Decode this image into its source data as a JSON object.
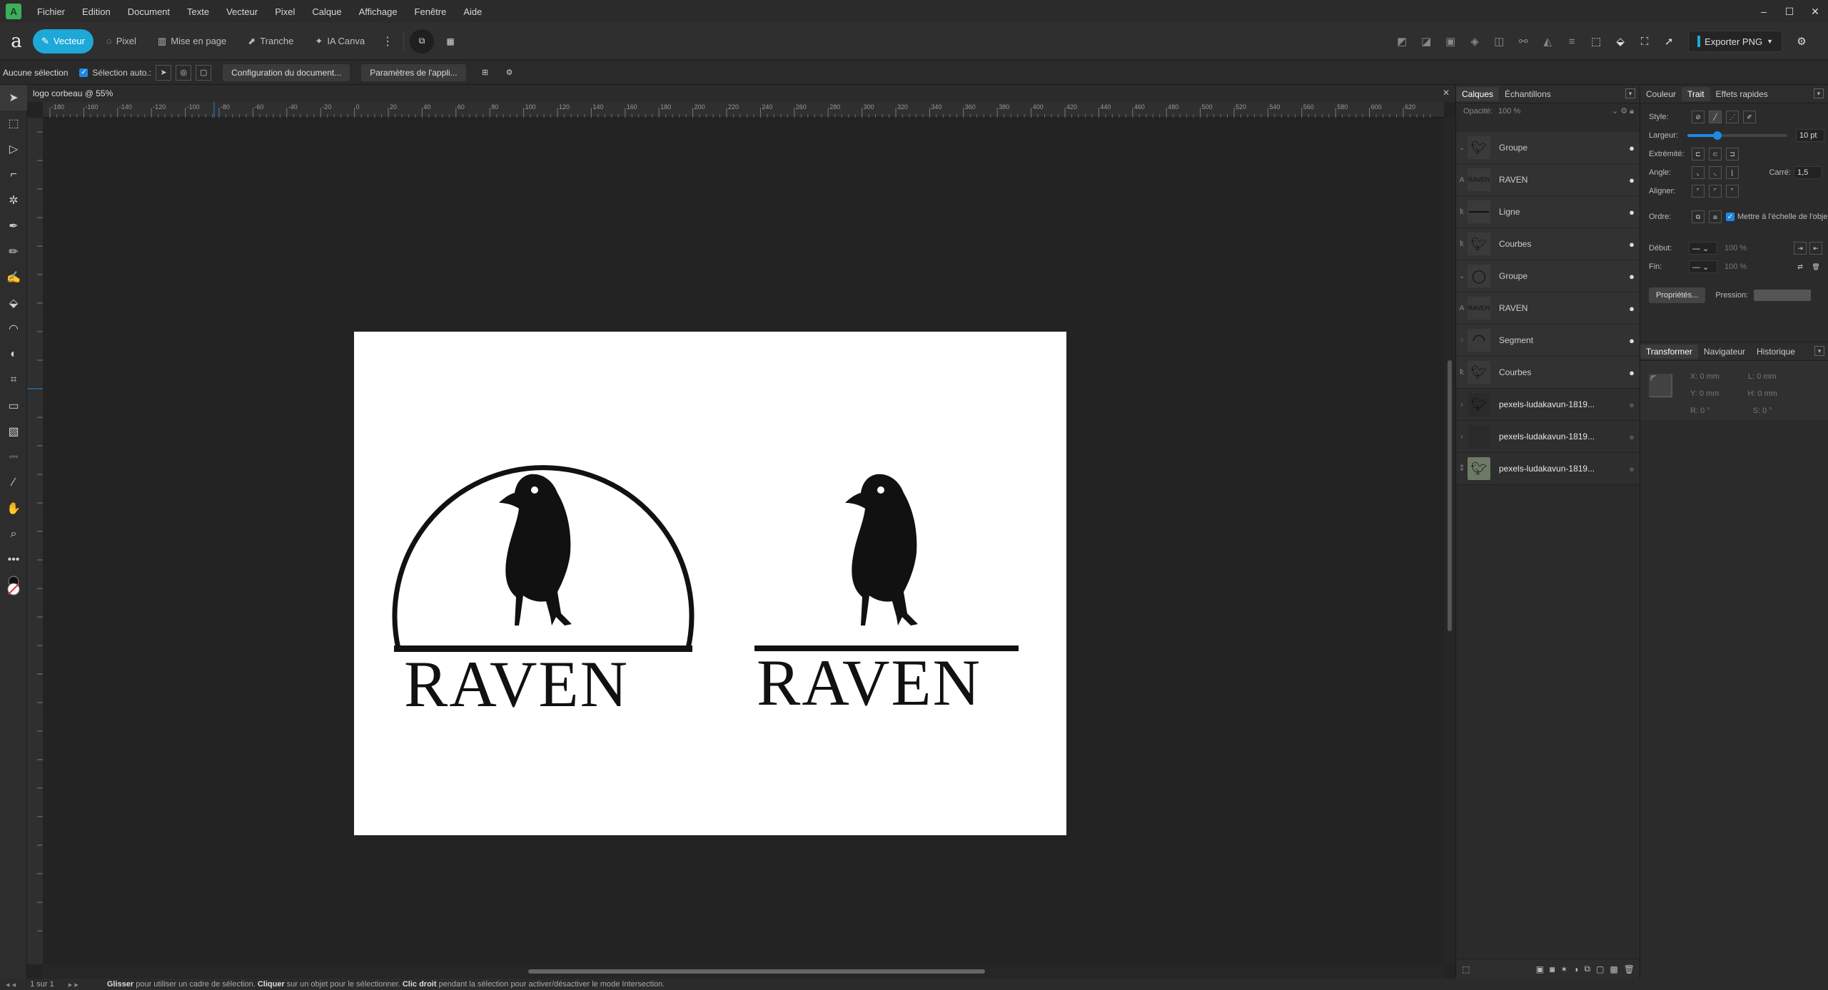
{
  "menu": {
    "items": [
      "Fichier",
      "Edition",
      "Document",
      "Texte",
      "Vecteur",
      "Pixel",
      "Calque",
      "Affichage",
      "Fenêtre",
      "Aide"
    ]
  },
  "toolbar": {
    "personas": [
      {
        "label": "Vecteur",
        "icon": "vector-icon",
        "active": true
      },
      {
        "label": "Pixel",
        "icon": "pixel-icon",
        "active": false
      },
      {
        "label": "Mise en page",
        "icon": "layout-icon",
        "active": false
      },
      {
        "label": "Tranche",
        "icon": "slice-icon",
        "active": false
      },
      {
        "label": "IA Canva",
        "icon": "ai-icon",
        "active": false
      }
    ],
    "export_label": "Exporter PNG"
  },
  "context": {
    "selection": "Aucune sélection",
    "auto_select": "Sélection auto.:",
    "doc_setup": "Configuration du document...",
    "app_settings": "Paramètres de l'appli..."
  },
  "document": {
    "tab_title": "logo corbeau @ 55%",
    "ruler_labels": [
      "-180",
      "-160",
      "-140",
      "-120",
      "-100",
      "-80",
      "-60",
      "-40",
      "-20",
      "0",
      "20",
      "40",
      "60",
      "80",
      "100",
      "120",
      "140",
      "160",
      "180",
      "200",
      "220",
      "240",
      "260",
      "280",
      "300",
      "320",
      "340",
      "360",
      "380",
      "400",
      "420",
      "440",
      "460",
      "480",
      "500",
      "520",
      "540",
      "560",
      "580",
      "600",
      "620"
    ],
    "logo_left_text": "RAVEN",
    "logo_right_text": "RAVEN"
  },
  "layers_panel": {
    "tabs": [
      "Calques",
      "Échantillons"
    ],
    "opacity_label": "Opacité:",
    "opacity_value": "100 %",
    "layers": [
      {
        "name": "Groupe",
        "type": "group",
        "visible": true
      },
      {
        "name": "RAVEN",
        "type": "text",
        "visible": true
      },
      {
        "name": "Ligne",
        "type": "line",
        "visible": true
      },
      {
        "name": "Courbes",
        "type": "curves",
        "visible": true
      },
      {
        "name": "Groupe",
        "type": "group",
        "visible": true
      },
      {
        "name": "RAVEN",
        "type": "text",
        "visible": true
      },
      {
        "name": "Segment",
        "type": "segment",
        "visible": true
      },
      {
        "name": "Courbes",
        "type": "curves",
        "visible": true
      },
      {
        "name": "pexels-ludakavun-1819...",
        "type": "image",
        "visible": false
      },
      {
        "name": "pexels-ludakavun-1819...",
        "type": "image",
        "visible": false
      },
      {
        "name": "pexels-ludakavun-1819...",
        "type": "image",
        "visible": false
      }
    ]
  },
  "stroke_panel": {
    "tabs": [
      "Couleur",
      "Trait",
      "Effets rapides"
    ],
    "style_label": "Style:",
    "width_label": "Largeur:",
    "width_value": "10 pt",
    "width_fraction": 0.3,
    "cap_label": "Extrémité:",
    "join_label": "Angle:",
    "miter_label": "Carré:",
    "miter_value": "1,5",
    "align_label": "Aligner:",
    "order_label": "Ordre:",
    "scale_label": "Mettre à l'échelle de l'obje",
    "start_label": "Début:",
    "end_label": "Fin:",
    "start_pct": "100 %",
    "end_pct": "100 %",
    "properties_label": "Propriétés...",
    "pressure_label": "Pression:"
  },
  "transform_panel": {
    "tabs": [
      "Transformer",
      "Navigateur",
      "Historique"
    ],
    "x_label": "X:",
    "x_value": "0 mm",
    "y_label": "Y:",
    "y_value": "0 mm",
    "w_label": "L:",
    "w_value": "0 mm",
    "h_label": "H:",
    "h_value": "0 mm",
    "r_label": "R:",
    "r_value": "0 °",
    "s_label": "S:",
    "s_value": "0 °"
  },
  "status": {
    "page": "1 sur 1",
    "hint_1": "Glisser",
    "hint_2": " pour utiliser un cadre de sélection. ",
    "hint_3": "Cliquer",
    "hint_4": " sur un objet pour le sélectionner. ",
    "hint_5": "Clic droit",
    "hint_6": " pendant la sélection pour activer/désactiver le mode Intersection."
  }
}
